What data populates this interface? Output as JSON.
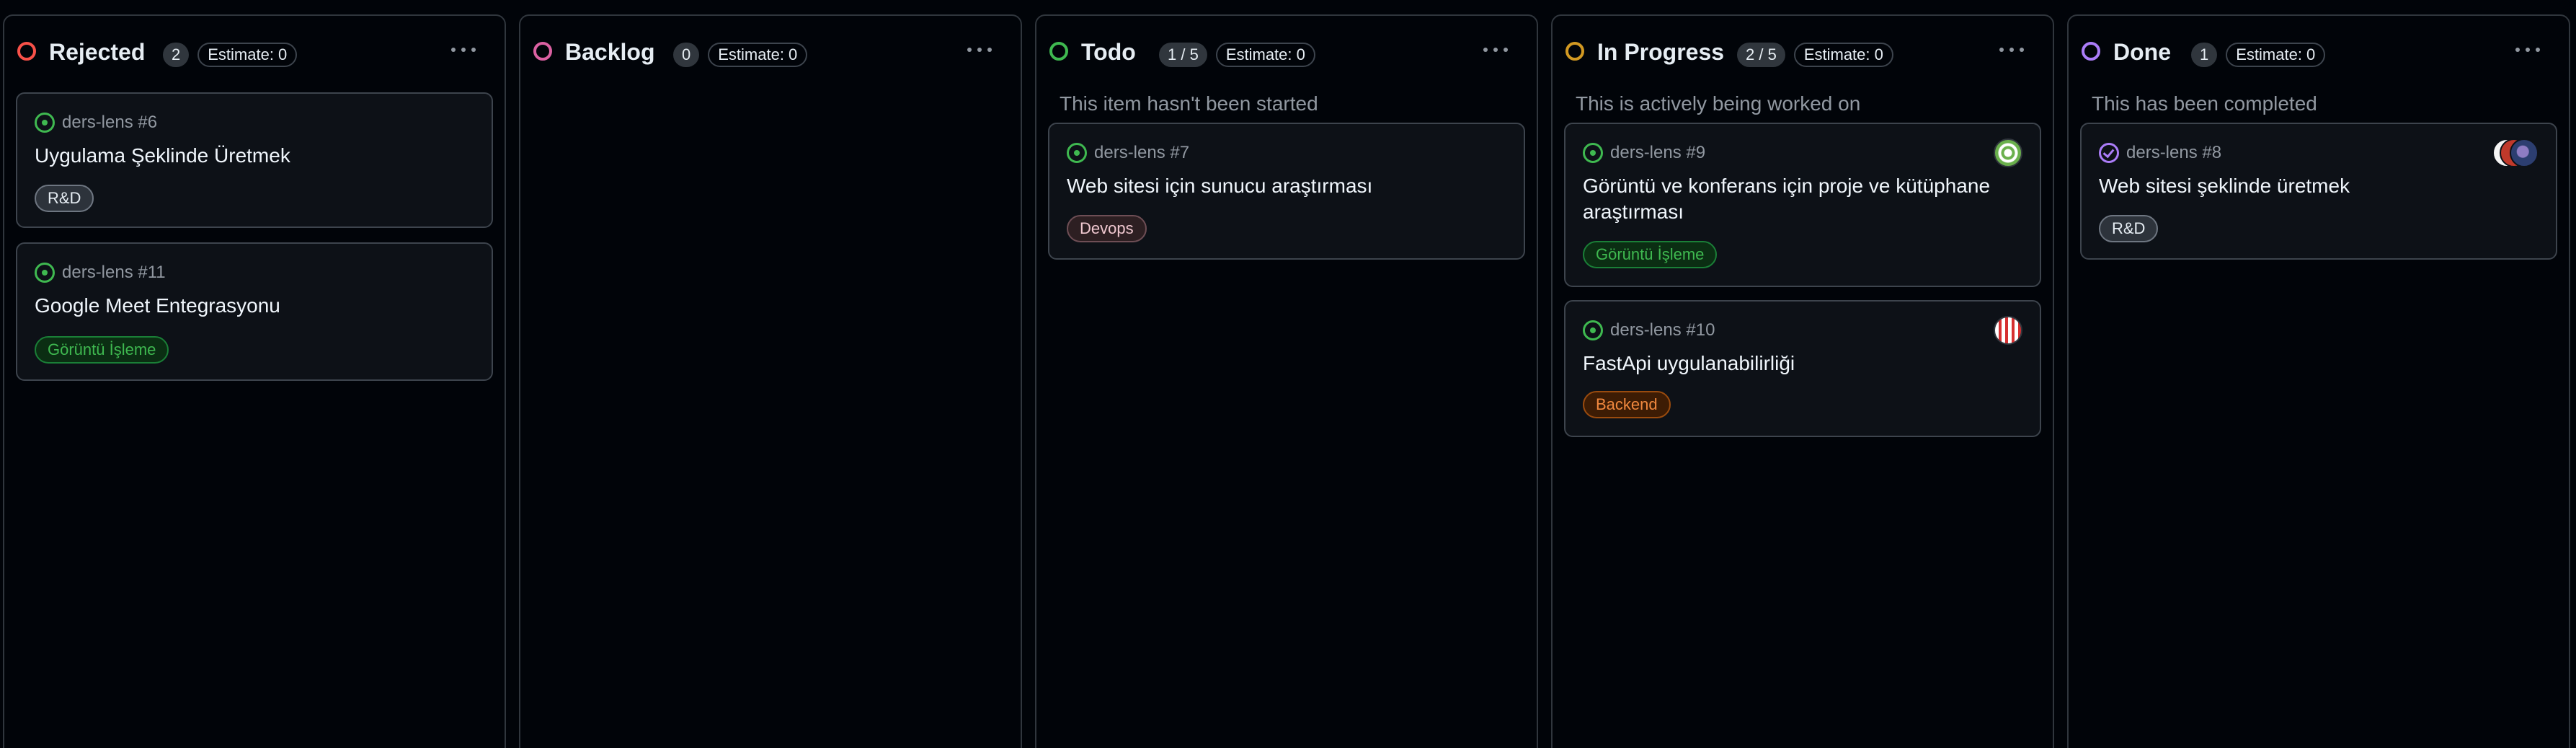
{
  "board": {
    "columns": [
      {
        "title": "Rejected",
        "count": "2",
        "estimate": "Estimate: 0",
        "status_color": "#f85149",
        "description": "",
        "cards": [
          {
            "repo": "ders-lens #6",
            "title": "Uygulama Şeklinde Üretmek",
            "label": "R&D"
          },
          {
            "repo": "ders-lens #11",
            "title": "Google Meet Entegrasyonu",
            "label": "Görüntü İşleme"
          }
        ]
      },
      {
        "title": "Backlog",
        "count": "0",
        "estimate": "Estimate: 0",
        "status_color": "#db61a2",
        "description": "",
        "cards": []
      },
      {
        "title": "Todo",
        "count": "1 / 5",
        "estimate": "Estimate: 0",
        "status_color": "#3fb950",
        "description": "This item hasn't been started",
        "cards": [
          {
            "repo": "ders-lens #7",
            "title": "Web sitesi için sunucu araştırması",
            "label": "Devops"
          }
        ]
      },
      {
        "title": "In Progress",
        "count": "2 / 5",
        "estimate": "Estimate: 0",
        "status_color": "#d29922",
        "description": "This is actively being worked on",
        "cards": [
          {
            "repo": "ders-lens #9",
            "title": "Görüntü ve konferans için proje ve kütüphane araştırması",
            "label": "Görüntü İşleme",
            "avatar": "green-pattern-avatar"
          },
          {
            "repo": "ders-lens #10",
            "title": "FastApi uygulanabilirliği",
            "label": "Backend",
            "avatar": "red-stripe-avatar"
          }
        ]
      },
      {
        "title": "Done",
        "count": "1",
        "estimate": "Estimate: 0",
        "status_color": "#ab7df8",
        "description": "This has been completed",
        "cards": [
          {
            "repo": "ders-lens #8",
            "title": "Web sitesi şeklinde üretmek",
            "label": "R&D",
            "avatar": "stacked-avatars"
          }
        ]
      }
    ]
  },
  "icons": {
    "open_issue": "issue-opened-icon",
    "closed_issue": "issue-closed-icon",
    "column_menu": "kebab-horizontal-icon"
  }
}
